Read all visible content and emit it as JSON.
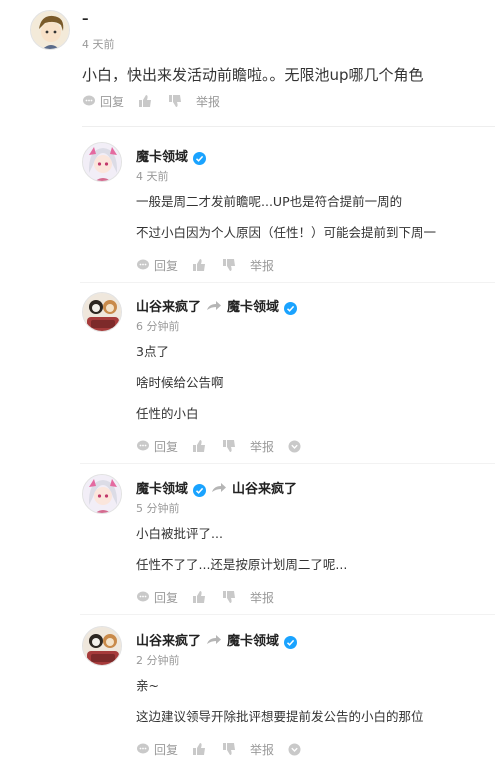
{
  "top_comment": {
    "username": "–",
    "time": "4 天前",
    "text": "小白，快出来发活动前瞻啦。。无限池up哪几个角色",
    "actions": {
      "reply": "回复",
      "report": "举报"
    }
  },
  "replies": [
    {
      "user": "魔卡领域",
      "verified": true,
      "reply_to": "",
      "time": "4 天前",
      "lines": [
        "一般是周二才发前瞻呢...UP也是符合提前一周的",
        "不过小白因为个人原因（任性！）可能会提前到下周一"
      ],
      "actions": {
        "reply": "回复",
        "report": "举报"
      }
    },
    {
      "user": "山谷来疯了",
      "verified": false,
      "reply_to": "魔卡领域",
      "reply_to_verified": true,
      "time": "6 分钟前",
      "lines": [
        "3点了",
        "啥时候给公告啊",
        "任性的小白"
      ],
      "actions": {
        "reply": "回复",
        "report": "举报"
      }
    },
    {
      "user": "魔卡领域",
      "verified": true,
      "reply_to": "山谷来疯了",
      "reply_to_verified": false,
      "time": "5 分钟前",
      "lines": [
        "小白被批评了...",
        "任性不了了...还是按原计划周二了呢..."
      ],
      "actions": {
        "reply": "回复",
        "report": "举报"
      }
    },
    {
      "user": "山谷来疯了",
      "verified": false,
      "reply_to": "魔卡领域",
      "reply_to_verified": true,
      "time": "2 分钟前",
      "lines": [
        "亲~",
        "这边建议领导开除批评想要提前发公告的小白的那位"
      ],
      "actions": {
        "reply": "回复",
        "report": "举报"
      }
    }
  ],
  "colors": {
    "verified": "#1aa3ff",
    "meta": "#999999",
    "text": "#333333"
  }
}
